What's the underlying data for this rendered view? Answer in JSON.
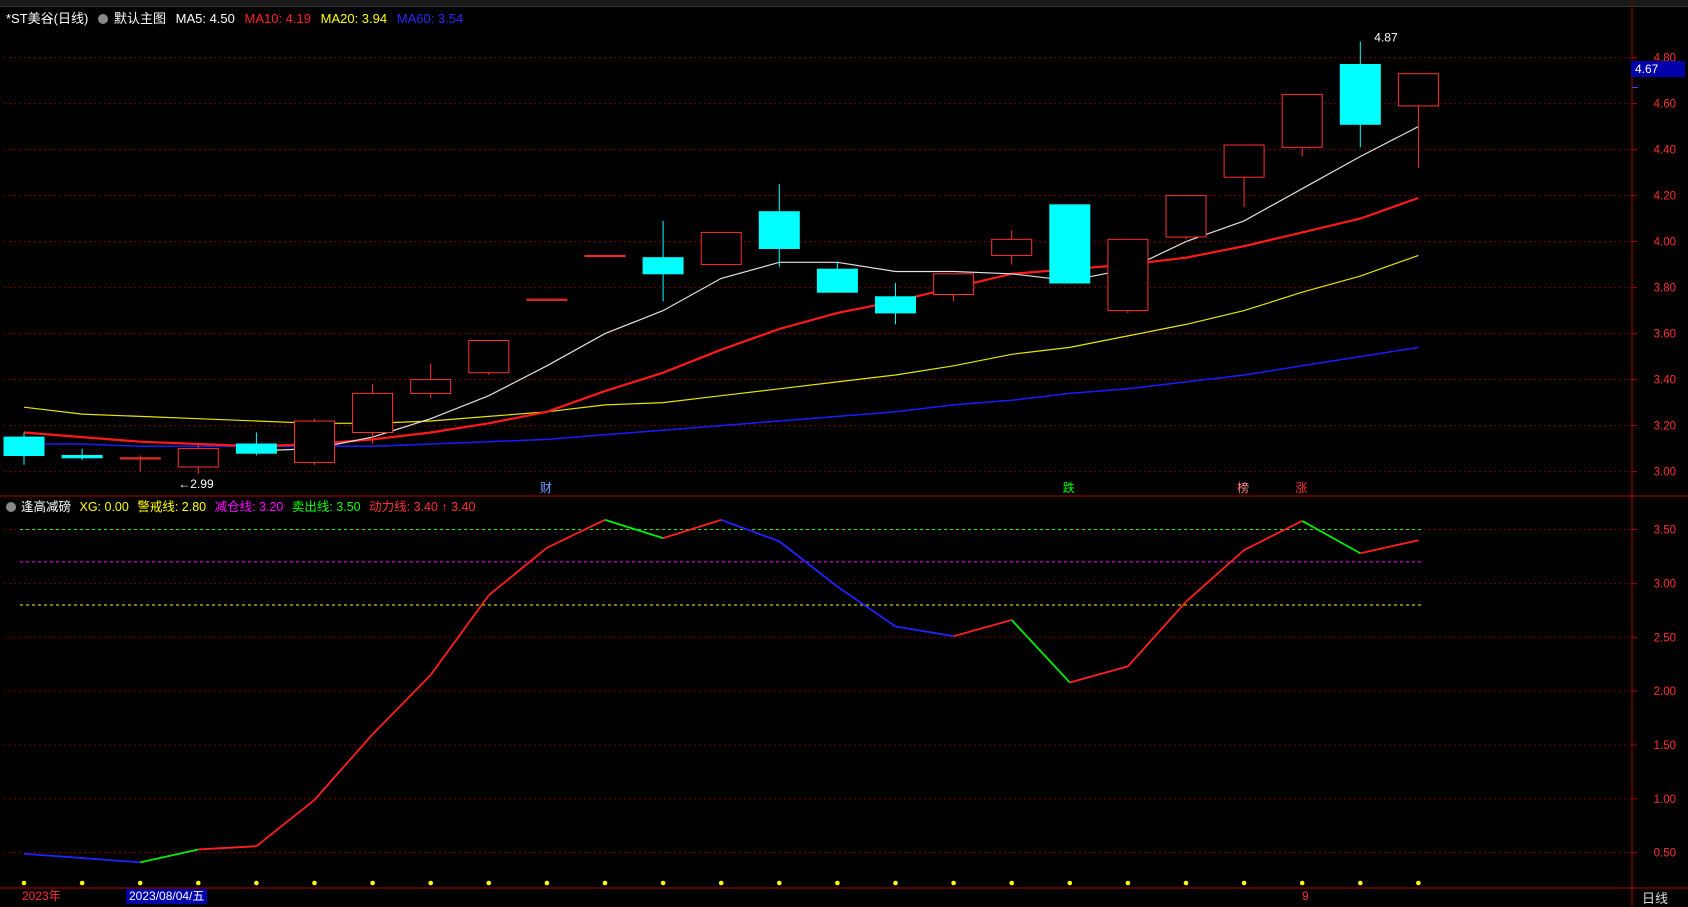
{
  "header": {
    "title": "*ST美谷(日线)",
    "main_chart_label": "默认主图",
    "ma": [
      {
        "label": "MA5: 4.50",
        "color": "#ffffff"
      },
      {
        "label": "MA10: 4.19",
        "color": "#ff2020"
      },
      {
        "label": "MA20: 3.94",
        "color": "#ffff00"
      },
      {
        "label": "MA60: 3.54",
        "color": "#0000ff"
      }
    ]
  },
  "indicator": {
    "name": "逢高减磅",
    "items": [
      {
        "label": "XG: 0.00",
        "color": "#ffff00"
      },
      {
        "label": "警戒线: 2.80",
        "color": "#ffff00"
      },
      {
        "label": "减仓线: 3.20",
        "color": "#ff00ff"
      },
      {
        "label": "卖出线: 3.50",
        "color": "#00ff00"
      },
      {
        "label": "动力线: 3.40 ↑ 3.40",
        "color": "#ff3030"
      }
    ]
  },
  "last_price": "4.67",
  "bottom": {
    "year": "2023年",
    "date": "2023/08/04/五",
    "month": "9",
    "period": "日线"
  },
  "chart_data": [
    {
      "type": "candlestick",
      "title": "*ST美谷(日线)",
      "ylim": [
        2.92,
        4.92
      ],
      "y_ticks": [
        "3.00",
        "3.20",
        "3.40",
        "3.60",
        "3.80",
        "4.00",
        "4.20",
        "4.40",
        "4.60",
        "4.80"
      ],
      "candles": [
        {
          "o": 3.15,
          "c": 3.07,
          "h": 3.17,
          "l": 3.03
        },
        {
          "o": 3.07,
          "c": 3.06,
          "h": 3.1,
          "l": 3.05
        },
        {
          "o": 3.06,
          "c": 3.06,
          "h": 3.07,
          "l": 3.0
        },
        {
          "o": 3.02,
          "c": 3.1,
          "h": 3.12,
          "l": 2.99
        },
        {
          "o": 3.12,
          "c": 3.08,
          "h": 3.17,
          "l": 3.07
        },
        {
          "o": 3.04,
          "c": 3.22,
          "h": 3.23,
          "l": 3.03
        },
        {
          "o": 3.17,
          "c": 3.34,
          "h": 3.38,
          "l": 3.12
        },
        {
          "o": 3.34,
          "c": 3.4,
          "h": 3.47,
          "l": 3.32
        },
        {
          "o": 3.43,
          "c": 3.57,
          "h": 3.57,
          "l": 3.42
        },
        {
          "o": 3.75,
          "c": 3.75,
          "h": 3.75,
          "l": 3.75
        },
        {
          "o": 3.94,
          "c": 3.94,
          "h": 3.94,
          "l": 3.94
        },
        {
          "o": 3.93,
          "c": 3.86,
          "h": 4.09,
          "l": 3.74
        },
        {
          "o": 3.9,
          "c": 4.04,
          "h": 4.04,
          "l": 3.9
        },
        {
          "o": 4.13,
          "c": 3.97,
          "h": 4.25,
          "l": 3.89
        },
        {
          "o": 3.88,
          "c": 3.78,
          "h": 3.91,
          "l": 3.78
        },
        {
          "o": 3.76,
          "c": 3.69,
          "h": 3.82,
          "l": 3.64
        },
        {
          "o": 3.77,
          "c": 3.86,
          "h": 3.86,
          "l": 3.74
        },
        {
          "o": 3.94,
          "c": 4.01,
          "h": 4.05,
          "l": 3.9
        },
        {
          "o": 4.16,
          "c": 3.82,
          "h": 4.16,
          "l": 3.82
        },
        {
          "o": 3.7,
          "c": 4.01,
          "h": 4.01,
          "l": 3.69
        },
        {
          "o": 4.02,
          "c": 4.2,
          "h": 4.2,
          "l": 4.01
        },
        {
          "o": 4.28,
          "c": 4.42,
          "h": 4.42,
          "l": 4.15
        },
        {
          "o": 4.41,
          "c": 4.64,
          "h": 4.64,
          "l": 4.37
        },
        {
          "o": 4.77,
          "c": 4.51,
          "h": 4.87,
          "l": 4.41
        },
        {
          "o": 4.59,
          "c": 4.73,
          "h": 4.73,
          "l": 4.32
        }
      ],
      "ma5": [
        null,
        null,
        null,
        null,
        3.09,
        3.1,
        3.15,
        3.23,
        3.33,
        3.46,
        3.6,
        3.7,
        3.84,
        3.91,
        3.91,
        3.87,
        3.87,
        3.86,
        3.83,
        3.88,
        4.0,
        4.09,
        4.23,
        4.37,
        4.5
      ],
      "ma10": [
        3.17,
        3.15,
        3.13,
        3.12,
        3.11,
        3.12,
        3.14,
        3.17,
        3.21,
        3.26,
        3.35,
        3.43,
        3.53,
        3.62,
        3.69,
        3.74,
        3.8,
        3.86,
        3.88,
        3.9,
        3.93,
        3.98,
        4.04,
        4.1,
        4.19
      ],
      "ma20": [
        3.28,
        3.25,
        3.24,
        3.23,
        3.22,
        3.21,
        3.21,
        3.22,
        3.24,
        3.26,
        3.29,
        3.3,
        3.33,
        3.36,
        3.39,
        3.42,
        3.46,
        3.51,
        3.54,
        3.59,
        3.64,
        3.7,
        3.78,
        3.85,
        3.94
      ],
      "ma60": [
        3.12,
        3.12,
        3.11,
        3.11,
        3.11,
        3.11,
        3.11,
        3.12,
        3.13,
        3.14,
        3.16,
        3.18,
        3.2,
        3.22,
        3.24,
        3.26,
        3.29,
        3.31,
        3.34,
        3.36,
        3.39,
        3.42,
        3.46,
        3.5,
        3.54
      ],
      "markers": [
        {
          "index": 9,
          "text": "财",
          "color": "#6ea0ff"
        },
        {
          "index": 18,
          "text": "跌",
          "color": "#00ff00"
        },
        {
          "index": 21,
          "text": "榜",
          "color": "#ff8080"
        },
        {
          "index": 22,
          "text": "涨",
          "color": "#ff3030"
        }
      ],
      "annotations": [
        {
          "index": 3,
          "text": "←2.99",
          "value": 2.99
        },
        {
          "index": 23,
          "text": "4.87",
          "value": 4.87
        }
      ]
    },
    {
      "type": "line",
      "title": "逢高减磅",
      "ylim": [
        0.2,
        3.7
      ],
      "y_ticks": [
        "0.50",
        "1.00",
        "1.50",
        "2.00",
        "2.50",
        "3.00",
        "3.50"
      ],
      "series": [
        {
          "name": "动力线",
          "values": [
            0.49,
            0.45,
            0.41,
            0.53,
            0.56,
            0.99,
            1.6,
            2.15,
            2.89,
            3.33,
            3.59,
            3.42,
            3.59,
            3.39,
            2.97,
            2.6,
            2.51,
            2.66,
            2.08,
            2.23,
            2.83,
            3.31,
            3.58,
            3.28,
            3.4
          ]
        },
        {
          "name": "卖出线",
          "values": [
            3.5
          ]
        },
        {
          "name": "减仓线",
          "values": [
            3.2
          ]
        },
        {
          "name": "警戒线",
          "values": [
            2.8
          ]
        },
        {
          "name": "XG",
          "values": [
            0,
            0,
            0,
            0,
            0,
            0,
            0,
            0,
            0,
            0,
            0,
            0,
            0,
            0,
            0,
            0,
            0,
            0,
            0,
            0,
            0,
            0,
            0,
            0,
            0
          ]
        }
      ]
    }
  ],
  "colors": {
    "up": "#ff3030",
    "down": "#00ffff",
    "grid": "#7a0000",
    "axis": "#b00000"
  }
}
